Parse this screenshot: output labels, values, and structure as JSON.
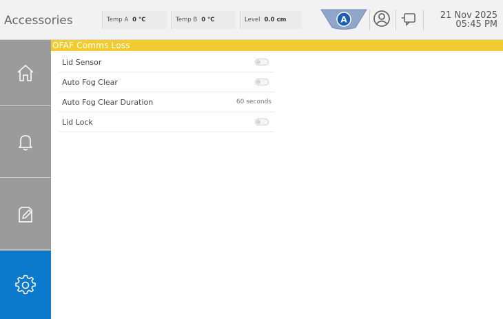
{
  "header": {
    "title": "Accessories",
    "temp_a": {
      "label": "Temp A",
      "value": "0 °C"
    },
    "temp_b": {
      "label": "Temp B",
      "value": "0 °C"
    },
    "level": {
      "label": "Level",
      "value": "0.0 cm"
    },
    "mode_badge": "A",
    "date": "21 Nov 2025",
    "time": "05:45 PM"
  },
  "sidebar": {
    "items": [
      {
        "name": "home",
        "icon": "home-icon",
        "active": false
      },
      {
        "name": "alarms",
        "icon": "bell-icon",
        "active": false
      },
      {
        "name": "notes",
        "icon": "edit-document-icon",
        "active": false
      },
      {
        "name": "settings",
        "icon": "gear-icon",
        "active": true
      }
    ]
  },
  "banner": {
    "text": "OFAF Comms Loss",
    "color": "#f1cb30"
  },
  "settings": {
    "rows": [
      {
        "label": "Lid Sensor",
        "type": "toggle",
        "on": false
      },
      {
        "label": "Auto Fog Clear",
        "type": "toggle",
        "on": false
      },
      {
        "label": "Auto Fog Clear Duration",
        "type": "value",
        "value": "60 seconds"
      },
      {
        "label": "Lid Lock",
        "type": "toggle",
        "on": false
      }
    ]
  },
  "colors": {
    "accent": "#0b7acc",
    "sidebar": "#9b9b9b",
    "header_bg": "#f2f2f2"
  }
}
